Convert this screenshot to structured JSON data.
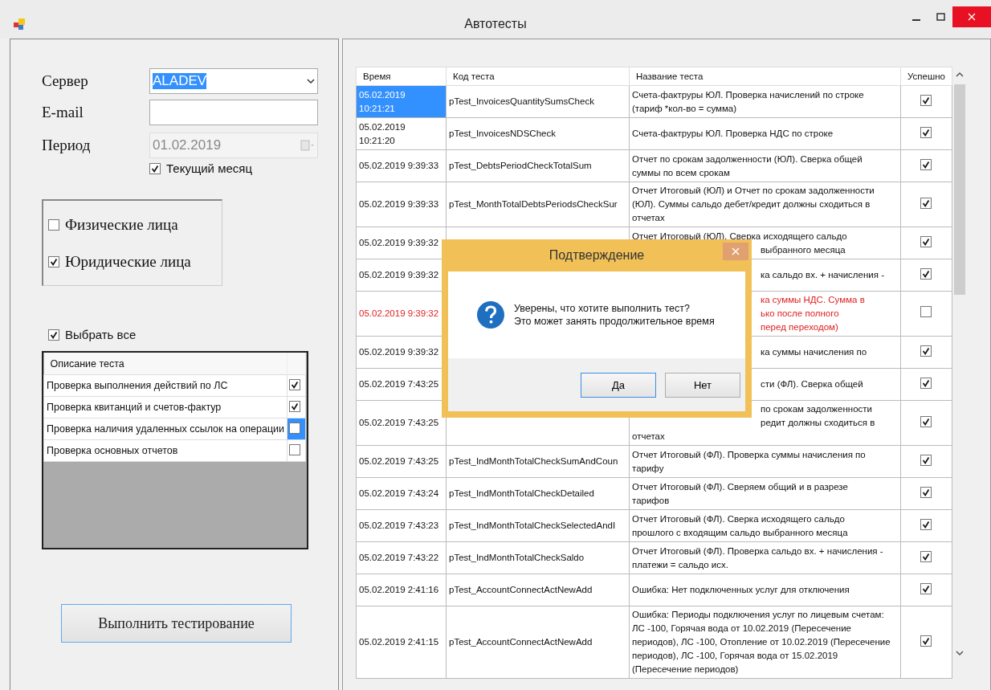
{
  "window": {
    "title": "Автотесты"
  },
  "form": {
    "server_label": "Сервер",
    "server_value": "ALADEV",
    "email_label": "E-mail",
    "period_label": "Период",
    "period_value": "01.02.2019",
    "period_disabled": true,
    "current_month": {
      "label": "Текущий месяц",
      "checked": true
    }
  },
  "person_types": [
    {
      "label": "Физические лица",
      "checked": false
    },
    {
      "label": "Юридические лица",
      "checked": true
    }
  ],
  "select_all": {
    "label": "Выбрать все",
    "checked": true
  },
  "test_groups": {
    "column": "Описание теста",
    "rows": [
      {
        "label": "Проверка выполнения действий по ЛС",
        "checked": true,
        "selected": false
      },
      {
        "label": "Проверка квитанций и счетов-фактур",
        "checked": true,
        "selected": false
      },
      {
        "label": "Проверка наличия удаленных ссылок на операции",
        "checked": false,
        "selected": true
      },
      {
        "label": "Проверка основных отчетов",
        "checked": false,
        "selected": false
      }
    ]
  },
  "run_button": "Выполнить тестирование",
  "results": {
    "columns": [
      "Время",
      "Код теста",
      "Название теста",
      "Успешно"
    ],
    "rows": [
      {
        "time": "05.02.2019\n10:21:21",
        "code": "pTest_InvoicesQuantitySumsCheck",
        "name": "Счета-фактруры ЮЛ. Проверка начислений по строке\n(тариф *кол-во = сумма)",
        "success": true,
        "selected": true,
        "failed": false
      },
      {
        "time": "05.02.2019\n10:21:20",
        "code": "pTest_InvoicesNDSCheck",
        "name": "Счета-фактруры ЮЛ. Проверка НДС по строке",
        "success": true,
        "selected": false,
        "failed": false
      },
      {
        "time": "05.02.2019 9:39:33",
        "code": "pTest_DebtsPeriodCheckTotalSum",
        "name": "Отчет по срокам задолженности (ЮЛ). Сверка общей\nсуммы по всем срокам",
        "success": true,
        "selected": false,
        "failed": false
      },
      {
        "time": "05.02.2019 9:39:33",
        "code": "pTest_MonthTotalDebtsPeriodsCheckSur",
        "name": "Отчет Итоговый (ЮЛ) и Отчет по срокам задолженности\n(ЮЛ). Суммы сальдо дебет/кредит должны сходиться в\nотчетах",
        "success": true,
        "selected": false,
        "failed": false
      },
      {
        "time": "05.02.2019 9:39:32",
        "name_parts": [
          {
            "text": "Отчет Итоговый (ЮЛ). Сверка исходящего сальдо",
            "partly_hidden": false
          },
          {
            "text": "выбранного месяца",
            "partly_hidden": true
          }
        ],
        "success": true,
        "selected": false,
        "failed": false
      },
      {
        "time": "05.02.2019 9:39:32",
        "name_parts": [
          {
            "text": "ка сальдо вх. + начисления -",
            "partly_hidden": true
          }
        ],
        "success": true,
        "selected": false,
        "failed": false
      },
      {
        "time": "05.02.2019 9:39:32",
        "name_parts": [
          {
            "text": "ка суммы НДС. Сумма в",
            "partly_hidden": true
          },
          {
            "text": "ько после полного",
            "partly_hidden": true
          },
          {
            "text": "перед переходом)",
            "partly_hidden": true
          }
        ],
        "success": false,
        "selected": false,
        "failed": true
      },
      {
        "time": "05.02.2019 9:39:32",
        "name_parts": [
          {
            "text": "ка суммы начисления по",
            "partly_hidden": true
          }
        ],
        "success": true,
        "selected": false,
        "failed": false
      },
      {
        "time": "05.02.2019 7:43:25",
        "name_parts": [
          {
            "text": "сти (ФЛ). Сверка общей",
            "partly_hidden": true
          }
        ],
        "success": true,
        "selected": false,
        "failed": false
      },
      {
        "time": "05.02.2019 7:43:25",
        "name_parts": [
          {
            "text": "по срокам задолженности",
            "partly_hidden": true
          },
          {
            "text": "редит должны сходиться в",
            "partly_hidden": true
          },
          {
            "text": "отчетах",
            "partly_hidden": false
          }
        ],
        "success": true,
        "selected": false,
        "failed": false
      },
      {
        "time": "05.02.2019 7:43:25",
        "code": "pTest_IndMonthTotalCheckSumAndCoun",
        "name": "Отчет Итоговый (ФЛ). Проверка суммы начисления по\nтарифу",
        "success": true,
        "selected": false,
        "failed": false
      },
      {
        "time": "05.02.2019 7:43:24",
        "code": "pTest_IndMonthTotalCheckDetailed",
        "name": "Отчет Итоговый (ФЛ). Сверяем общий и в разрезе\nтарифов",
        "success": true,
        "selected": false,
        "failed": false
      },
      {
        "time": "05.02.2019 7:43:23",
        "code": "pTest_IndMonthTotalCheckSelectedAndI",
        "name": "Отчет Итоговый (ФЛ). Сверка исходящего сальдо\nпрошлого с входящим сальдо выбранного месяца",
        "success": true,
        "selected": false,
        "failed": false
      },
      {
        "time": "05.02.2019 7:43:22",
        "code": "pTest_IndMonthTotalCheckSaldo",
        "name": "Отчет Итоговый (ФЛ). Проверка сальдо вх. + начисления -\nплатежи = сальдо исх.",
        "success": true,
        "selected": false,
        "failed": false
      },
      {
        "time": "05.02.2019 2:41:16",
        "code": "pTest_AccountConnectActNewAdd",
        "name": "Ошибка: Нет подключенных услуг для отключения",
        "success": true,
        "selected": false,
        "failed": false
      },
      {
        "time": "05.02.2019 2:41:15",
        "code": "pTest_AccountConnectActNewAdd",
        "name": "Ошибка: Периоды подключения услуг по лицевым счетам:\nЛС -100, Горячая вода от 10.02.2019 (Пересечение\nпериодов), ЛС -100, Отопление от 10.02.2019 (Пересечение\nпериодов), ЛС -100, Горячая вода от 15.02.2019\n(Пересечение периодов)",
        "success": true,
        "selected": false,
        "failed": false
      }
    ]
  },
  "dialog": {
    "title": "Подтверждение",
    "message": "Уверены, что хотите выполнить тест?\nЭто может занять продолжительное время",
    "buttons": [
      {
        "label": "Да",
        "default": true
      },
      {
        "label": "Нет",
        "default": false
      }
    ]
  }
}
